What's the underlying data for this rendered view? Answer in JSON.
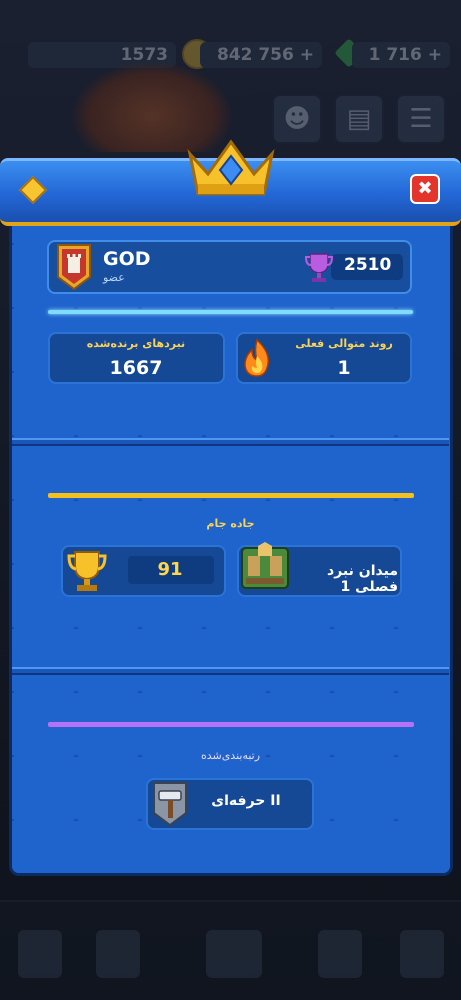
{
  "top_bar": {
    "level_value": "1573",
    "gold_value": "842 756",
    "gems_value": "1 716"
  },
  "modal": {
    "close_icon": "x-icon",
    "player": {
      "name": "GOD",
      "role": "عضو",
      "trophies": "2510"
    },
    "stats": {
      "current_win_streak_title": "روند متوالی فعلی",
      "current_win_streak_value": "1",
      "battles_won_title": "نبردهای برنده‌شده",
      "battles_won_value": "1667"
    },
    "trophy_road": {
      "title": "جاده جام",
      "trophies_value": "91",
      "arena_name": "میدان نبرد فصلی 1"
    },
    "ranked": {
      "title": "رتبه‌بندی‌شده",
      "league_value": "حرفه‌ای II"
    }
  },
  "colors": {
    "gold_accent": "#f4c01d",
    "streak_line": "#7fdcff",
    "ranked_line": "#b672f5",
    "panel_blue": "#1f63cc",
    "close_red": "#e3352b"
  }
}
